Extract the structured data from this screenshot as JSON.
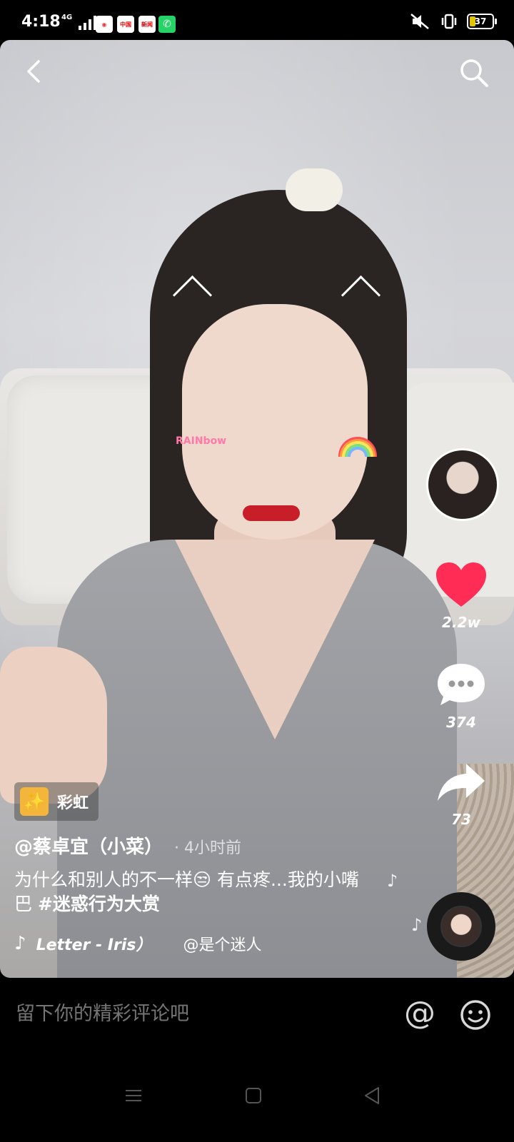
{
  "status_bar": {
    "time": "4:18",
    "network": "4G",
    "battery": "37",
    "apps": [
      {
        "name": "qq-browser-icon",
        "color": "#ffffff",
        "text": ""
      },
      {
        "name": "news-app-icon",
        "color": "#e02020",
        "text": "中国"
      },
      {
        "name": "news-app-icon-2",
        "color": "#ffffff",
        "text": "新闻"
      },
      {
        "name": "whatsapp-icon",
        "color": "#25d366",
        "text": ""
      }
    ]
  },
  "header": {
    "back_icon": "chevron-left-icon",
    "search_icon": "search-icon"
  },
  "actions": {
    "likes": "2.2w",
    "comments": "374",
    "shares": "73",
    "like_color": "#ff2d55"
  },
  "effect": {
    "label": "彩虹"
  },
  "post": {
    "author": "@蔡卓宜（小菜）",
    "time": "· 4小时前",
    "caption_text": "为什么和别人的不一样😒 有点疼...我的小嘴巴 ",
    "hashtag": "#迷惑行为大赏"
  },
  "music": {
    "title": "Letter - Iris）",
    "author": "@是个迷人"
  },
  "comment_bar": {
    "placeholder": "留下你的精彩评论吧",
    "at_label": "@"
  },
  "sticker": {
    "text": "RAINbow"
  }
}
